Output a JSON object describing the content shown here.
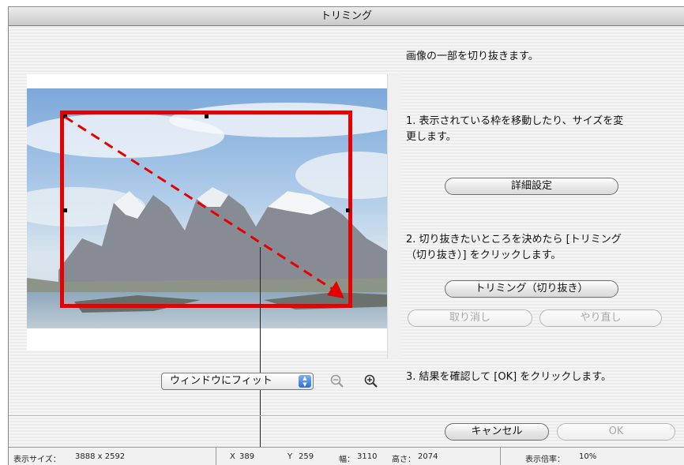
{
  "window": {
    "title": "トリミング"
  },
  "instructions": {
    "intro": "画像の一部を切り抜きます。",
    "step1_line1": "1. 表示されている枠を移動したり、サイズを変",
    "step1_line2": "更します。",
    "step2_line1": "2. 切り抜きたいところを決めたら [トリミング",
    "step2_line2": "（切り抜き）] をクリックします。",
    "step3": "3. 結果を確認して [OK] をクリックします。"
  },
  "buttons": {
    "advanced": "詳細設定",
    "trim": "トリミング（切り抜き）",
    "undo": "取り消し",
    "redo": "やり直し",
    "cancel": "キャンセル",
    "ok": "OK"
  },
  "zoom": {
    "selected": "ウィンドウにフィット"
  },
  "status": {
    "display_size_label": "表示サイズ：",
    "display_size_value": "3888 x 2592",
    "x_label": "X",
    "x_value": "389",
    "y_label": "Y",
    "y_value": "259",
    "width_label": "幅：",
    "width_value": "3110",
    "height_label": "高さ：",
    "height_value": "2074",
    "scale_label": "表示倍率：",
    "scale_value": "10%"
  },
  "colors": {
    "crop_frame": "#e60000",
    "window_bg": "#ececec"
  },
  "icons": [
    "zoom-out-icon",
    "zoom-in-icon",
    "select-arrows-icon",
    "resize-arrow-icon"
  ]
}
